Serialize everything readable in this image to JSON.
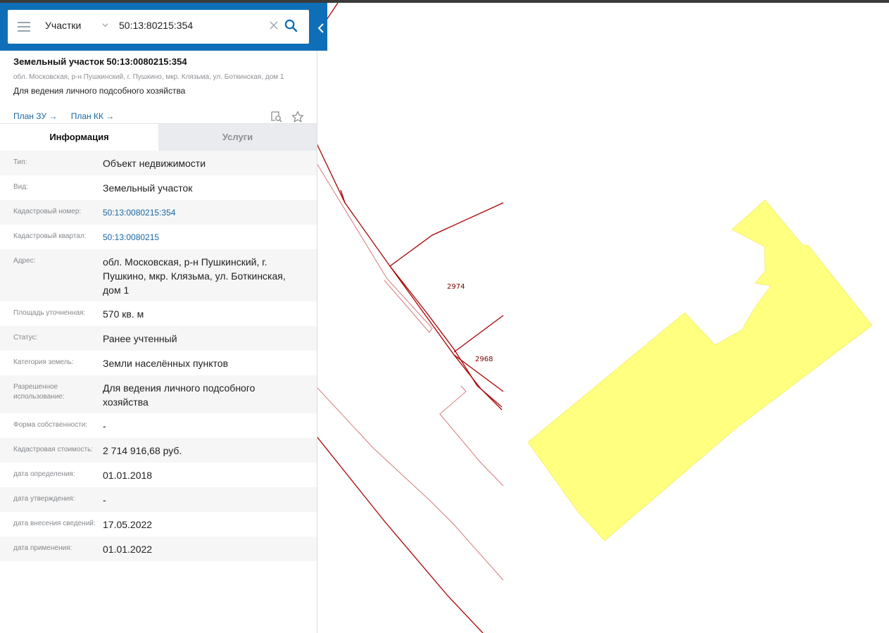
{
  "search": {
    "layer": "Участки",
    "query": "50:13:80215:354"
  },
  "card": {
    "title": "Земельный участок 50:13:0080215:354",
    "address": "обл. Московская, р-н Пушкинский, г. Пушкино, мкр. Клязьма, ул. Боткинская, дом 1",
    "purpose": "Для ведения личного подсобного хозяйства",
    "plan_zu": "План ЗУ →",
    "plan_kk": "План КК →"
  },
  "tabs": {
    "info": "Информация",
    "services": "Услуги"
  },
  "attributes": [
    {
      "label": "Тип:",
      "value": "Объект недвижимости"
    },
    {
      "label": "Вид:",
      "value": "Земельный участок"
    },
    {
      "label": "Кадастровый номер:",
      "value": "50:13:0080215:354",
      "link": true
    },
    {
      "label": "Кадастровый квартал:",
      "value": "50:13:0080215",
      "link": true
    },
    {
      "label": "Адрес:",
      "value": "обл. Московская, р-н Пушкинский, г. Пушкино, мкр. Клязьма, ул. Боткинская, дом 1"
    },
    {
      "label": "Площадь уточненная:",
      "value": "570 кв. м"
    },
    {
      "label": "Статус:",
      "value": "Ранее учтенный"
    },
    {
      "label": "Категория земель:",
      "value": "Земли населённых пунктов"
    },
    {
      "label": "Разрешенное использование:",
      "value": "Для ведения личного подсобного хозяйства"
    },
    {
      "label": "Форма собственности:",
      "value": "-"
    },
    {
      "label": "Кадастровая стоимость:",
      "value": "2 714 916,68 руб."
    },
    {
      "label": "дата определения:",
      "value": "01.01.2018"
    },
    {
      "label": "дата утверждения:",
      "value": "-"
    },
    {
      "label": "дата внесения сведений:",
      "value": "17.05.2022"
    },
    {
      "label": "дата применения:",
      "value": "01.01.2022"
    }
  ],
  "map": {
    "labels": {
      "a": "2974",
      "b": "2968"
    },
    "colors": {
      "boundary": "#a80000",
      "boundary_light": "#d77a7a",
      "parcel_fill": "#ffff80"
    }
  },
  "icons": [
    "menu-icon",
    "chevron-down-icon",
    "close-icon",
    "search-icon",
    "chevron-left-icon",
    "map-search-icon",
    "star-icon"
  ]
}
